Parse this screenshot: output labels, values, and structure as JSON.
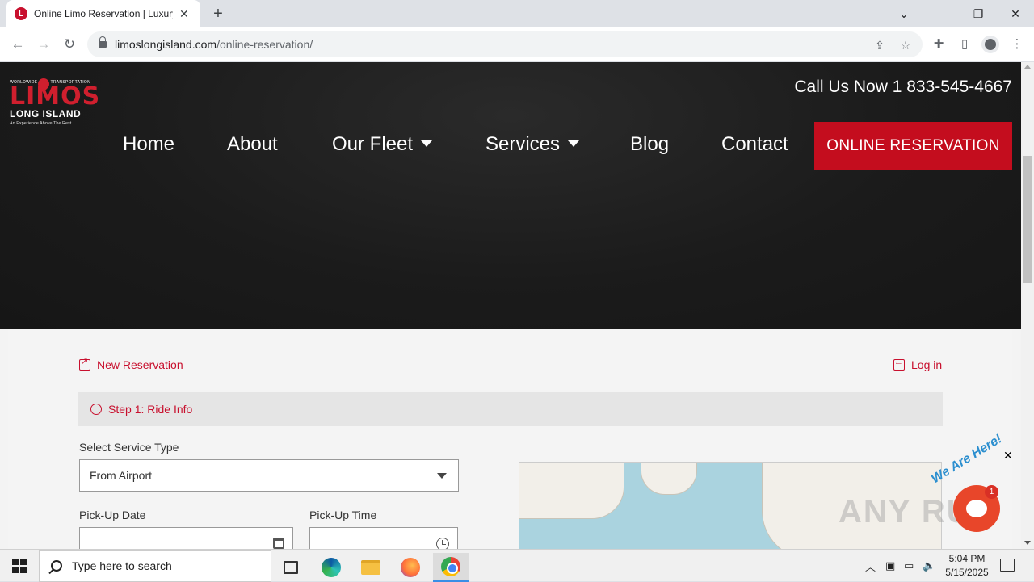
{
  "browser": {
    "tab_title": "Online Limo Reservation | Luxury",
    "tab_favicon_letter": "L",
    "url_host": "limoslongisland.com",
    "url_path": "/online-reservation/"
  },
  "site": {
    "logo": {
      "top_left": "WORLDWIDE",
      "top_right": "TRANSPORTATION",
      "name": "LIMOS",
      "sub": "LONG ISLAND",
      "tagline": "An Experience Above The Rest"
    },
    "phone": "Call Us Now 1 833-545-4667",
    "nav": [
      {
        "label": "Home"
      },
      {
        "label": "About"
      },
      {
        "label": "Our Fleet"
      },
      {
        "label": "Services"
      },
      {
        "label": "Blog"
      },
      {
        "label": "Contact"
      }
    ],
    "reserve_button": "ONLINE RESERVATION"
  },
  "form": {
    "new_reservation": "New Reservation",
    "login": "Log in",
    "step": "Step 1: Ride Info",
    "service_type_label": "Select Service Type",
    "service_type_value": "From Airport",
    "pickup_date_label": "Pick-Up Date",
    "pickup_time_label": "Pick-Up Time"
  },
  "chat": {
    "teaser": "We Are Here!",
    "badge_count": "1"
  },
  "taskbar": {
    "search_placeholder": "Type here to search",
    "time": "5:04 PM",
    "date": "5/15/2025"
  },
  "colors": {
    "brand_red": "#c40d1e",
    "hero_dark": "#1b1b1b"
  }
}
